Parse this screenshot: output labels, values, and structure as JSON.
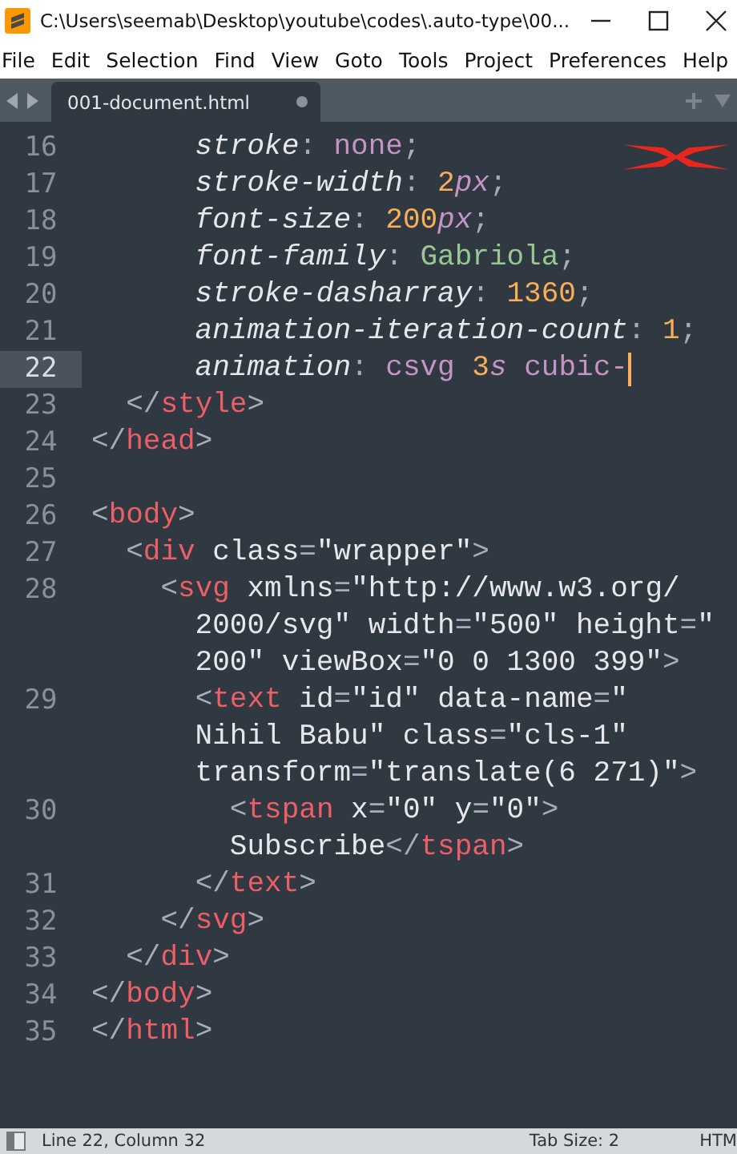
{
  "window": {
    "title": "C:\\Users\\seemab\\Desktop\\youtube\\codes\\.auto-type\\00..."
  },
  "menu": [
    "File",
    "Edit",
    "Selection",
    "Find",
    "View",
    "Goto",
    "Tools",
    "Project",
    "Preferences",
    "Help"
  ],
  "tabs": [
    {
      "label": "001-document.html",
      "selected": true,
      "modified": true
    }
  ],
  "editor": {
    "lines": [
      {
        "number": "16",
        "current": false,
        "rows": [
          "      stroke: none;"
        ]
      },
      {
        "number": "17",
        "current": false,
        "rows": [
          "      stroke-width: 2px;"
        ]
      },
      {
        "number": "18",
        "current": false,
        "rows": [
          "      font-size: 200px;"
        ]
      },
      {
        "number": "19",
        "current": false,
        "rows": [
          "      font-family: Gabriola;"
        ]
      },
      {
        "number": "20",
        "current": false,
        "rows": [
          "      stroke-dasharray: 1360;"
        ]
      },
      {
        "number": "21",
        "current": false,
        "rows": [
          "      animation-iteration-count: 1;"
        ]
      },
      {
        "number": "22",
        "current": true,
        "rows": [
          "      animation: csvg 3s cubic-"
        ]
      },
      {
        "number": "23",
        "current": false,
        "rows": [
          "  </style>"
        ]
      },
      {
        "number": "24",
        "current": false,
        "rows": [
          "</head>"
        ]
      },
      {
        "number": "25",
        "current": false
      },
      {
        "number": "26",
        "current": false,
        "rows": [
          "<body>"
        ]
      },
      {
        "number": "27",
        "current": false,
        "rows": [
          "  <div class=\"wrapper\">"
        ]
      },
      {
        "number": "28",
        "current": false,
        "rows": [
          "    <svg xmlns=\"http://www.w3.org/",
          "      2000/svg\" width=\"500\" height=\"",
          "      200\" viewBox=\"0 0 1300 399\">"
        ]
      },
      {
        "number": "29",
        "current": false,
        "rows": [
          "      <text id=\"id\" data-name=\"",
          "      Nihil Babu\" class=\"cls-1\"",
          "      transform=\"translate(6 271)\">"
        ]
      },
      {
        "number": "30",
        "current": false,
        "rows": [
          "        <tspan x=\"0\" y=\"0\">",
          "        Subscribe</tspan>"
        ]
      },
      {
        "number": "31",
        "current": false,
        "rows": [
          "      </text>"
        ]
      },
      {
        "number": "32",
        "current": false,
        "rows": [
          "    </svg>"
        ]
      },
      {
        "number": "33",
        "current": false,
        "rows": [
          "  </div>"
        ]
      },
      {
        "number": "34",
        "current": false,
        "rows": [
          "</body>"
        ]
      },
      {
        "number": "35",
        "current": false,
        "rows": [
          "</html>"
        ]
      }
    ]
  },
  "status_bar": {
    "position": "Line 22, Column 32",
    "tab_size": "Tab Size: 2",
    "syntax": "HTM"
  }
}
